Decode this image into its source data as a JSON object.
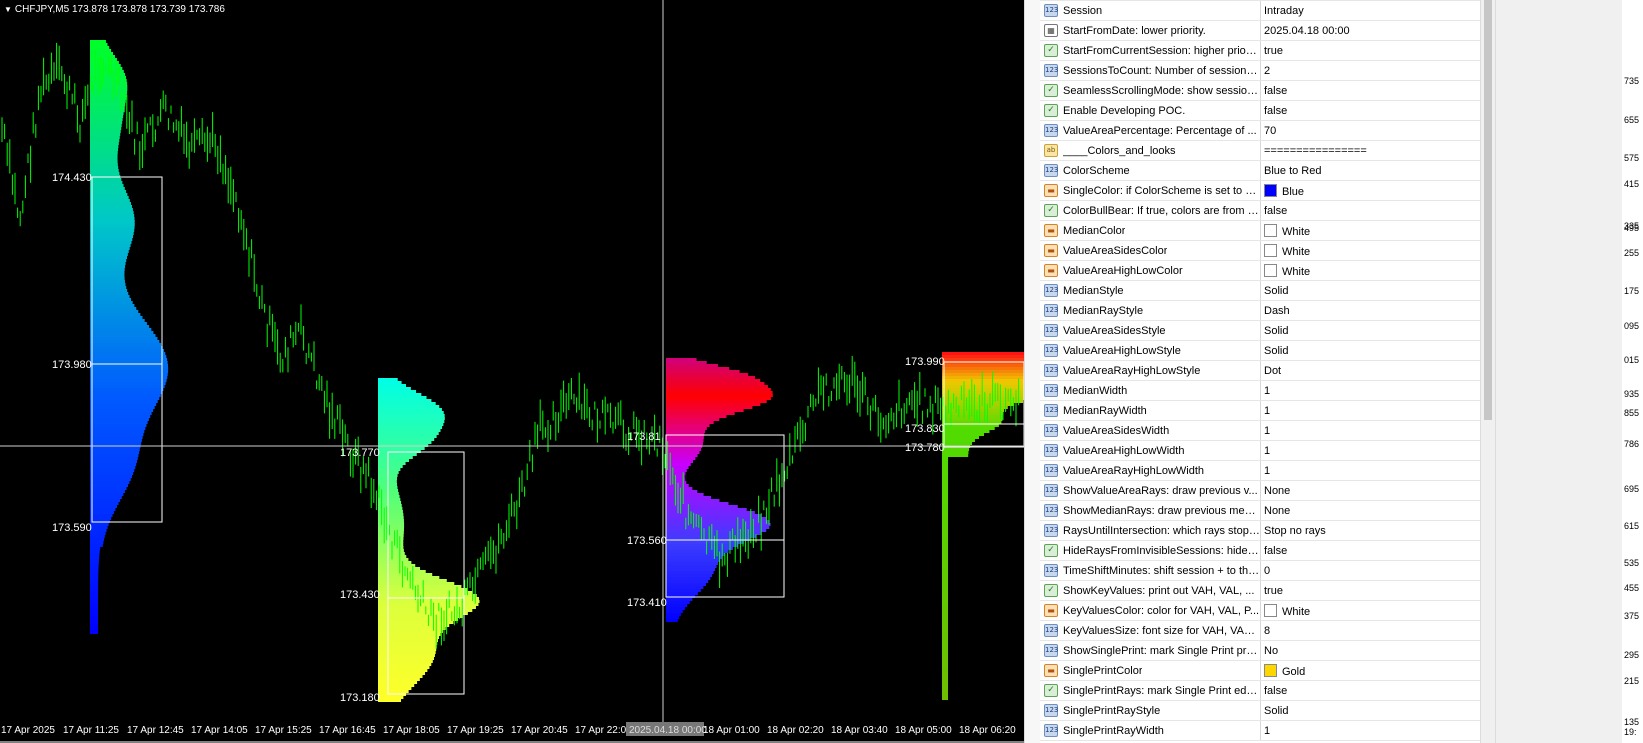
{
  "chart": {
    "title": "CHFJPY,M5  173.878 173.878 173.739 173.786",
    "x_labels": [
      "17 Apr 2025",
      "17 Apr 11:25",
      "17 Apr 12:45",
      "17 Apr 14:05",
      "17 Apr 15:25",
      "17 Apr 16:45",
      "17 Apr 18:05",
      "17 Apr 19:25",
      "17 Apr 20:45",
      "17 Apr 22:05",
      "2025.04.18 00:00",
      "18 Apr 01:00",
      "18 Apr 02:20",
      "18 Apr 03:40",
      "18 Apr 05:00",
      "18 Apr 06:20"
    ],
    "cursor_time_label": "2025.04.18 00:00",
    "level_labels": [
      "174.430",
      "173.980",
      "173.590",
      "173.770",
      "173.430",
      "173.180",
      "173.81",
      "173.560",
      "173.410",
      "173.990",
      "173.830",
      "173.780"
    ],
    "candle_color": "#00ff00",
    "background": "#000000"
  },
  "properties": {
    "rows": [
      {
        "icon": "int-icon",
        "type": "int",
        "name": "Session",
        "value": "Intraday"
      },
      {
        "icon": "date-icon",
        "type": "date",
        "name": "StartFromDate: lower priority.",
        "value": "2025.04.18 00:00"
      },
      {
        "icon": "bool-icon",
        "type": "bool",
        "name": "StartFromCurrentSession: higher priority.",
        "value": "true"
      },
      {
        "icon": "int-icon",
        "type": "int",
        "name": "SessionsToCount: Number of sessions ...",
        "value": "2"
      },
      {
        "icon": "bool-icon",
        "type": "bool",
        "name": "SeamlessScrollingMode: show session...",
        "value": "false"
      },
      {
        "icon": "bool-icon",
        "type": "bool",
        "name": "Enable Developing POC.",
        "value": "false"
      },
      {
        "icon": "int-icon",
        "type": "int",
        "name": "ValueAreaPercentage: Percentage of ...",
        "value": "70"
      },
      {
        "icon": "string-icon",
        "type": "str",
        "name": "____Colors_and_looks",
        "value": "================"
      },
      {
        "icon": "int-icon",
        "type": "int",
        "name": "ColorScheme",
        "value": "Blue to Red"
      },
      {
        "icon": "color-icon",
        "type": "color",
        "name": "SingleColor: if ColorScheme is set to Si...",
        "value": "Blue",
        "swatch": "#0000ff"
      },
      {
        "icon": "bool-icon",
        "type": "bool",
        "name": "ColorBullBear: If true, colors are from b...",
        "value": "false"
      },
      {
        "icon": "color-icon",
        "type": "color",
        "name": "MedianColor",
        "value": "White",
        "swatch": "#ffffff"
      },
      {
        "icon": "color-icon",
        "type": "color",
        "name": "ValueAreaSidesColor",
        "value": "White",
        "swatch": "#ffffff"
      },
      {
        "icon": "color-icon",
        "type": "color",
        "name": "ValueAreaHighLowColor",
        "value": "White",
        "swatch": "#ffffff"
      },
      {
        "icon": "int-icon",
        "type": "int",
        "name": "MedianStyle",
        "value": "Solid"
      },
      {
        "icon": "int-icon",
        "type": "int",
        "name": "MedianRayStyle",
        "value": "Dash"
      },
      {
        "icon": "int-icon",
        "type": "int",
        "name": "ValueAreaSidesStyle",
        "value": "Solid"
      },
      {
        "icon": "int-icon",
        "type": "int",
        "name": "ValueAreaHighLowStyle",
        "value": "Solid"
      },
      {
        "icon": "int-icon",
        "type": "int",
        "name": "ValueAreaRayHighLowStyle",
        "value": "Dot"
      },
      {
        "icon": "int-icon",
        "type": "int",
        "name": "MedianWidth",
        "value": "1"
      },
      {
        "icon": "int-icon",
        "type": "int",
        "name": "MedianRayWidth",
        "value": "1"
      },
      {
        "icon": "int-icon",
        "type": "int",
        "name": "ValueAreaSidesWidth",
        "value": "1"
      },
      {
        "icon": "int-icon",
        "type": "int",
        "name": "ValueAreaHighLowWidth",
        "value": "1"
      },
      {
        "icon": "int-icon",
        "type": "int",
        "name": "ValueAreaRayHighLowWidth",
        "value": "1"
      },
      {
        "icon": "int-icon",
        "type": "int",
        "name": "ShowValueAreaRays: draw previous v...",
        "value": "None"
      },
      {
        "icon": "int-icon",
        "type": "int",
        "name": "ShowMedianRays: draw previous medi...",
        "value": "None"
      },
      {
        "icon": "int-icon",
        "type": "int",
        "name": "RaysUntilIntersection: which rays stop ...",
        "value": "Stop no rays"
      },
      {
        "icon": "bool-icon",
        "type": "bool",
        "name": "HideRaysFromInvisibleSessions: hide r...",
        "value": "false"
      },
      {
        "icon": "int-icon",
        "type": "int",
        "name": "TimeShiftMinutes: shift session + to the...",
        "value": "0"
      },
      {
        "icon": "bool-icon",
        "type": "bool",
        "name": "ShowKeyValues: print out VAH, VAL, ...",
        "value": "true"
      },
      {
        "icon": "color-icon",
        "type": "color",
        "name": "KeyValuesColor: color for VAH, VAL, P...",
        "value": "White",
        "swatch": "#ffffff"
      },
      {
        "icon": "int-icon",
        "type": "int",
        "name": "KeyValuesSize: font size for VAH, VAL,...",
        "value": "8"
      },
      {
        "icon": "int-icon",
        "type": "int",
        "name": "ShowSinglePrint: mark Single Print prof...",
        "value": "No"
      },
      {
        "icon": "color-icon",
        "type": "color",
        "name": "SinglePrintColor",
        "value": "Gold",
        "swatch": "#ffd700"
      },
      {
        "icon": "bool-icon",
        "type": "bool",
        "name": "SinglePrintRays: mark Single Print edg...",
        "value": "false"
      },
      {
        "icon": "int-icon",
        "type": "int",
        "name": "SinglePrintRayStyle",
        "value": "Solid"
      },
      {
        "icon": "int-icon",
        "type": "int",
        "name": "SinglePrintRayWidth",
        "value": "1"
      }
    ]
  },
  "edge_axis": {
    "labels": [
      "735",
      "655",
      "575",
      "495",
      "415",
      "335",
      "255",
      "175",
      "095",
      "015",
      "935",
      "855",
      "786",
      "695",
      "615",
      "535",
      "455",
      "375",
      "295",
      "215",
      "135",
      "19:"
    ]
  }
}
